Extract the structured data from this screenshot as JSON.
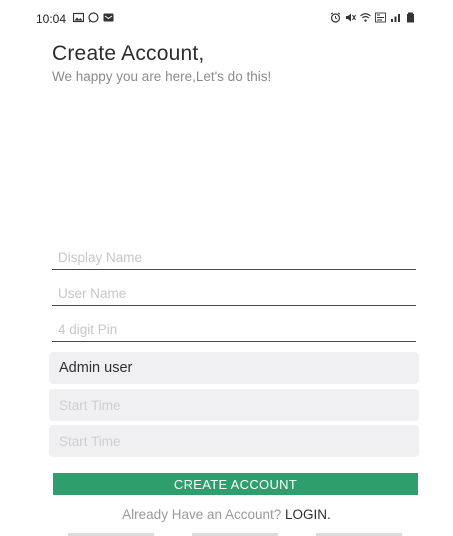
{
  "status_bar": {
    "time": "10:04",
    "left_icons": [
      "gallery-icon",
      "whatsapp-icon",
      "message-icon"
    ],
    "right_icons": [
      "alarm-icon",
      "mute-icon",
      "wifi-icon",
      "volte-icon",
      "signal-icon",
      "battery-icon"
    ]
  },
  "header": {
    "title": "Create Account,",
    "subtitle": "We happy you are here,Let's do this!"
  },
  "form": {
    "display_name_placeholder": "Display Name",
    "user_name_placeholder": "User Name",
    "pin_placeholder": "4 digit Pin",
    "role_value": "Admin user",
    "start_time_placeholder_1": "Start Time",
    "start_time_placeholder_2": "Start Time",
    "submit_label": "CREATE ACCOUNT"
  },
  "footer": {
    "prompt_text": "Already Have an Account?",
    "login_link": "LOGIN."
  },
  "colors": {
    "primary": "#2e9e6d",
    "input_bg": "#f0f0f2"
  }
}
